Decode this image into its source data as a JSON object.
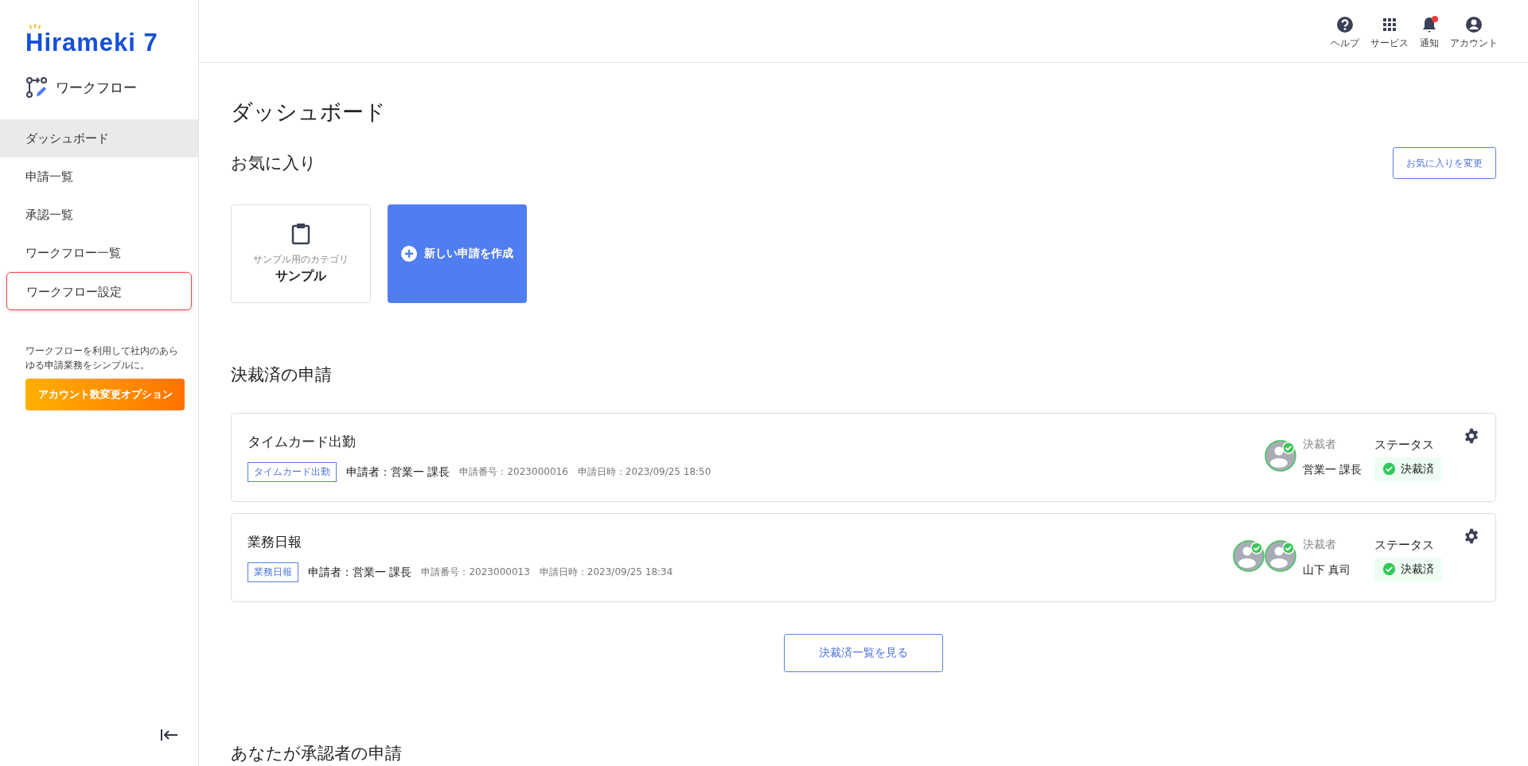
{
  "sidebar": {
    "logo": "Hirameki 7",
    "app_title": "ワークフロー",
    "items": [
      {
        "label": "ダッシュボード",
        "selected": true,
        "highlighted": false
      },
      {
        "label": "申請一覧",
        "selected": false,
        "highlighted": false
      },
      {
        "label": "承認一覧",
        "selected": false,
        "highlighted": false
      },
      {
        "label": "ワークフロー一覧",
        "selected": false,
        "highlighted": false
      },
      {
        "label": "ワークフロー設定",
        "selected": false,
        "highlighted": true
      }
    ],
    "description": "ワークフローを利用して社内のあらゆる申請業務をシンプルに。",
    "option_button": "アカウント数変更オプション"
  },
  "header": {
    "actions": [
      {
        "kind": "help",
        "label": "ヘルプ",
        "badge": false
      },
      {
        "kind": "services",
        "label": "サービス",
        "badge": false
      },
      {
        "kind": "notifications",
        "label": "通知",
        "badge": true
      },
      {
        "kind": "account",
        "label": "アカウント",
        "badge": false
      }
    ]
  },
  "page_title": "ダッシュボード",
  "favorites": {
    "title": "お気に入り",
    "change_button": "お気に入りを変更",
    "category_caption": "サンプル用のカテゴリ",
    "category_name": "サンプル",
    "create_button": "新しい申請を作成"
  },
  "approved_section": {
    "title": "決裁済の申請",
    "requests": [
      {
        "title": "タイムカード出勤",
        "tag": "タイムカード出勤",
        "applicant": "申請者：営業一 課長",
        "number": "申請番号：2023000016",
        "date": "申請日時：2023/09/25 18:50",
        "approver_label": "決裁者",
        "approver": "営業一 課長",
        "avatars": [
          {
            "approved": true
          }
        ],
        "status_label": "ステータス",
        "status": {
          "kind": "approved",
          "text": "決裁済"
        }
      },
      {
        "title": "業務日報",
        "tag": "業務日報",
        "applicant": "申請者：営業一 課長",
        "number": "申請番号：2023000013",
        "date": "申請日時：2023/09/25 18:34",
        "approver_label": "決裁者",
        "approver": "山下 真司",
        "avatars": [
          {
            "approved": true
          },
          {
            "approved": true
          }
        ],
        "status_label": "ステータス",
        "status": {
          "kind": "approved",
          "text": "決裁済"
        }
      }
    ],
    "view_all_button": "決裁済一覧を見る"
  },
  "approver_section": {
    "title": "あなたが承認者の申請"
  }
}
